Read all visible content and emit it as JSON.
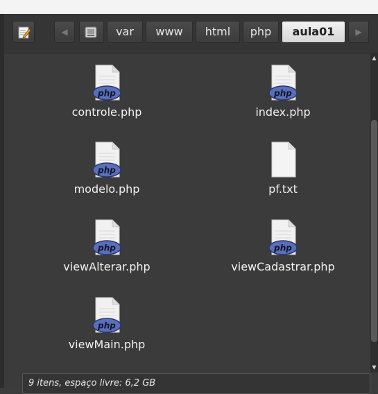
{
  "pathbar": {
    "segments": [
      "var",
      "www",
      "html",
      "php",
      "aula01"
    ],
    "active": "aula01"
  },
  "files": [
    {
      "name": "controle.php",
      "type": "php"
    },
    {
      "name": "index.php",
      "type": "php"
    },
    {
      "name": "modelo.php",
      "type": "php"
    },
    {
      "name": "pf.txt",
      "type": "text"
    },
    {
      "name": "viewAlterar.php",
      "type": "php"
    },
    {
      "name": "viewCadastrar.php",
      "type": "php"
    },
    {
      "name": "viewMain.php",
      "type": "php"
    }
  ],
  "icon_badge": "php",
  "status": {
    "text": "9 itens, espaço livre: 6,2 GB"
  },
  "colors": {
    "background": "#3b3b3b",
    "active_segment": "#e6e6e6",
    "php_badge": "#5a6fb8"
  }
}
